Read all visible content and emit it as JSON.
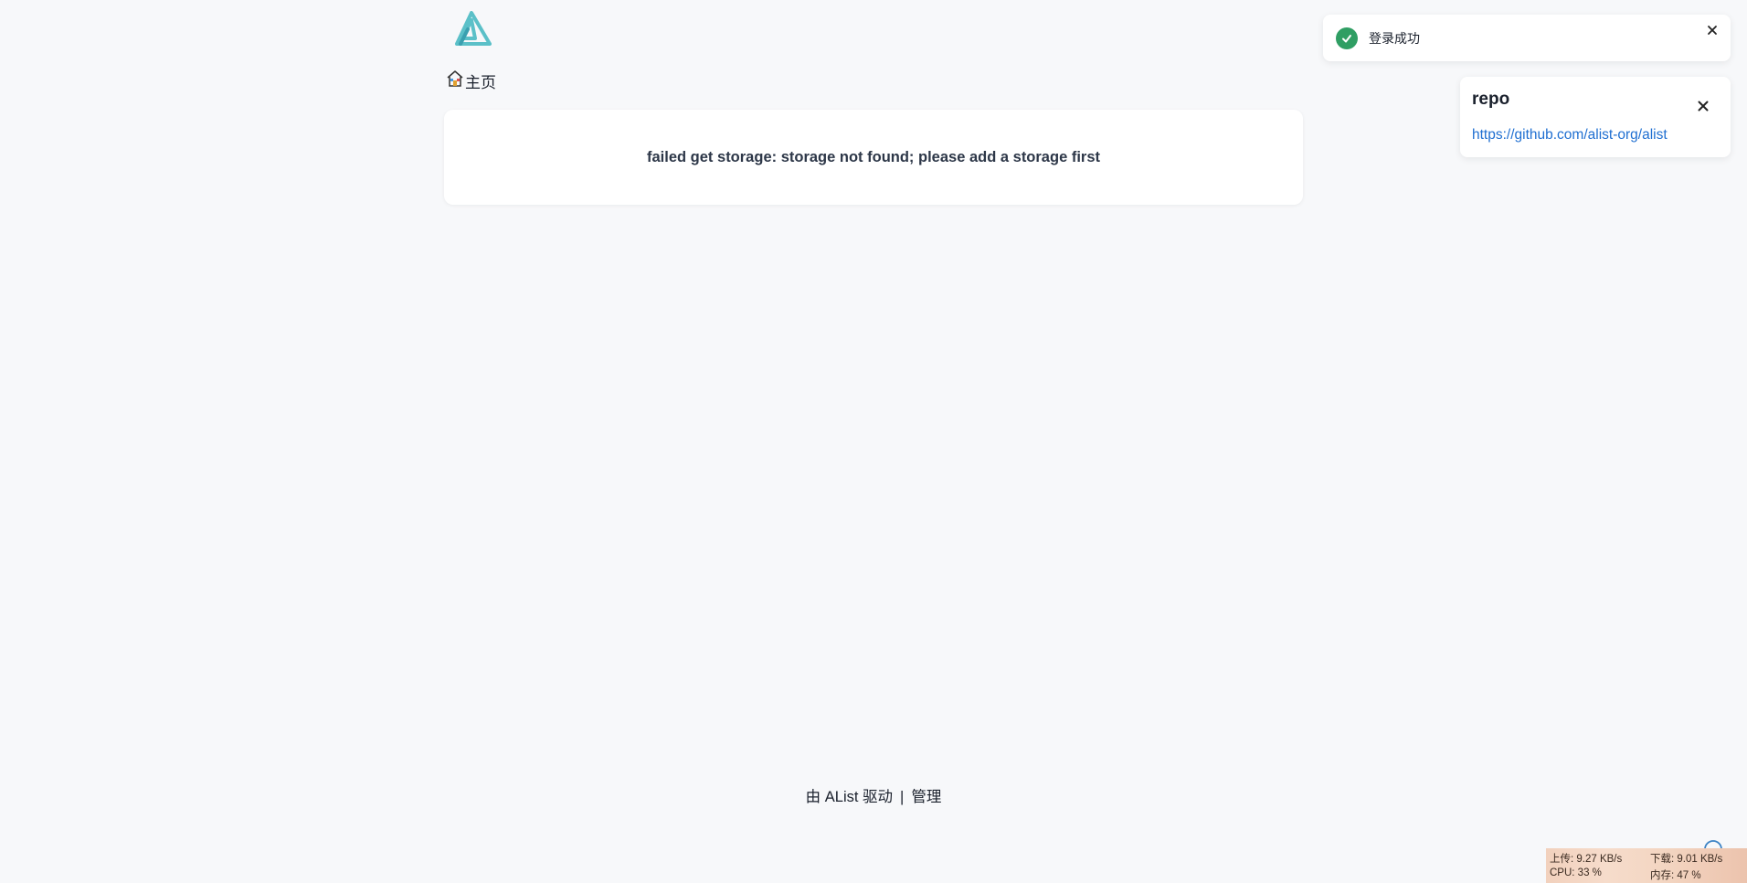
{
  "header": {
    "logo_icon": "alist-logo-icon",
    "breadcrumb": {
      "icon": "home-icon",
      "label": "主页"
    }
  },
  "main": {
    "error_message": "failed get storage: storage not found; please add a storage first"
  },
  "toast": {
    "icon": "check-circle-icon",
    "message": "登录成功",
    "close_icon": "close-icon",
    "status_color": "#2f9e63"
  },
  "notice": {
    "title": "repo",
    "link": "https://github.com/alist-org/alist",
    "close_icon": "close-icon"
  },
  "footer": {
    "powered_by": "由 AList 驱动",
    "separator": "|",
    "manage_link": "管理"
  },
  "netmon": {
    "upload": "上传: 9.27 KB/s",
    "download": "下载: 9.01 KB/s",
    "cpu": "CPU: 33 %",
    "memory": "内存: 47 %"
  },
  "colors": {
    "background": "#f7f8fa",
    "card": "#ffffff",
    "link": "#1f6fd1",
    "logo": "#5bc0c8"
  }
}
